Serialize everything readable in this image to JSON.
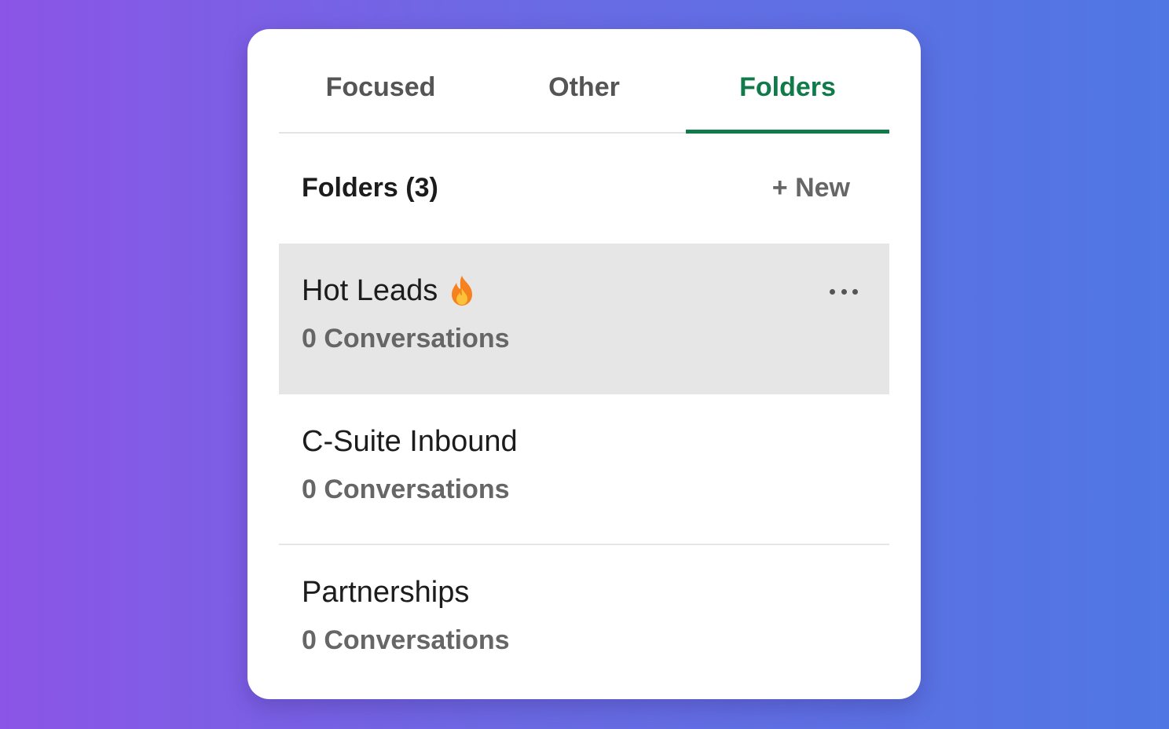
{
  "tabs": [
    {
      "label": "Focused",
      "active": false
    },
    {
      "label": "Other",
      "active": false
    },
    {
      "label": "Folders",
      "active": true
    }
  ],
  "folders_header": {
    "title": "Folders (3)",
    "new_label": "+ New"
  },
  "folders": [
    {
      "name": "Hot Leads",
      "icon": "flame-icon",
      "count_label": "0 Conversations",
      "selected": true
    },
    {
      "name": "C-Suite Inbound",
      "count_label": "0 Conversations",
      "selected": false
    },
    {
      "name": "Partnerships",
      "count_label": "0 Conversations",
      "selected": false
    }
  ],
  "colors": {
    "accent": "#117a4a",
    "selected_row": "#e6e6e6",
    "gradient_start": "#8b55e6",
    "gradient_end": "#4f77e3"
  }
}
